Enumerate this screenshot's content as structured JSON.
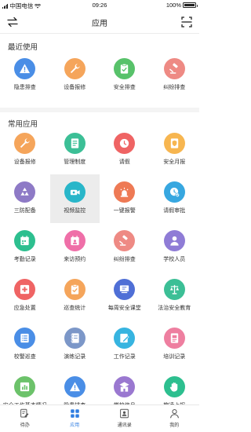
{
  "status_bar": {
    "carrier": "中国电信",
    "network": "令",
    "time": "09:26",
    "battery": "100%",
    "battery_level": 1.0
  },
  "header": {
    "title": "应用"
  },
  "sections": {
    "recent_title": "最近使用",
    "common_title": "常用应用"
  },
  "recent": [
    {
      "label": "隐患排查",
      "color": "#4a8ee6",
      "icon": "warning-icon"
    },
    {
      "label": "设备报修",
      "color": "#f5a55b",
      "icon": "wrench-icon"
    },
    {
      "label": "安全排查",
      "color": "#58c26a",
      "icon": "clipboard-check-icon"
    },
    {
      "label": "纠纷排查",
      "color": "#ee8a84",
      "icon": "gavel-icon"
    }
  ],
  "common": [
    {
      "label": "设备报修",
      "color": "#f5a55b",
      "icon": "wrench-icon"
    },
    {
      "label": "管理制度",
      "color": "#3cbf96",
      "icon": "document-icon"
    },
    {
      "label": "请假",
      "color": "#ef6464",
      "icon": "clock-icon"
    },
    {
      "label": "安全月报",
      "color": "#f7b650",
      "icon": "shield-document-icon"
    },
    {
      "label": "三防配备",
      "color": "#8e7ac6",
      "icon": "recycle-icon"
    },
    {
      "label": "视频监控",
      "color": "#29b6c9",
      "icon": "camera-icon"
    },
    {
      "label": "一键报警",
      "color": "#ee7a55",
      "icon": "alarm-icon"
    },
    {
      "label": "请假审批",
      "color": "#37a7e0",
      "icon": "clock-check-icon"
    },
    {
      "label": "考勤记录",
      "color": "#2dbf8f",
      "icon": "calendar-icon"
    },
    {
      "label": "来访预约",
      "color": "#ef6fa8",
      "icon": "calendar-user-icon"
    },
    {
      "label": "纠纷排查",
      "color": "#ee8a84",
      "icon": "gavel-icon"
    },
    {
      "label": "学校人员",
      "color": "#8f7cd6",
      "icon": "person-icon"
    },
    {
      "label": "应急处置",
      "color": "#ef6464",
      "icon": "emergency-icon"
    },
    {
      "label": "巡查统计",
      "color": "#f5a55b",
      "icon": "clipboard-check-icon"
    },
    {
      "label": "每周安全课堂",
      "color": "#4f6fd6",
      "icon": "classroom-icon"
    },
    {
      "label": "法治安全教育",
      "color": "#3cbf96",
      "icon": "law-icon"
    },
    {
      "label": "校警巡查",
      "color": "#4a8ee6",
      "icon": "list-icon"
    },
    {
      "label": "演练记录",
      "color": "#7c97c8",
      "icon": "notebook-icon"
    },
    {
      "label": "工作记录",
      "color": "#37b4e0",
      "icon": "pencil-doc-icon"
    },
    {
      "label": "培训记录",
      "color": "#ee7fa0",
      "icon": "training-icon"
    },
    {
      "label": "安全工作基本情况",
      "color": "#6cc26a",
      "icon": "chart-icon"
    },
    {
      "label": "隐患排查",
      "color": "#4a8ee6",
      "icon": "warning-icon"
    },
    {
      "label": "学校信息",
      "color": "#9a78d0",
      "icon": "school-icon"
    },
    {
      "label": "欺凌上报",
      "color": "#2dbf8f",
      "icon": "hand-icon"
    }
  ],
  "tabs": [
    {
      "label": "待办",
      "icon": "todo-icon",
      "active": false
    },
    {
      "label": "应用",
      "icon": "apps-icon",
      "active": true
    },
    {
      "label": "通讯录",
      "icon": "contacts-icon",
      "active": false
    },
    {
      "label": "我的",
      "icon": "profile-icon",
      "active": false
    }
  ],
  "selected_item": "视频监控"
}
